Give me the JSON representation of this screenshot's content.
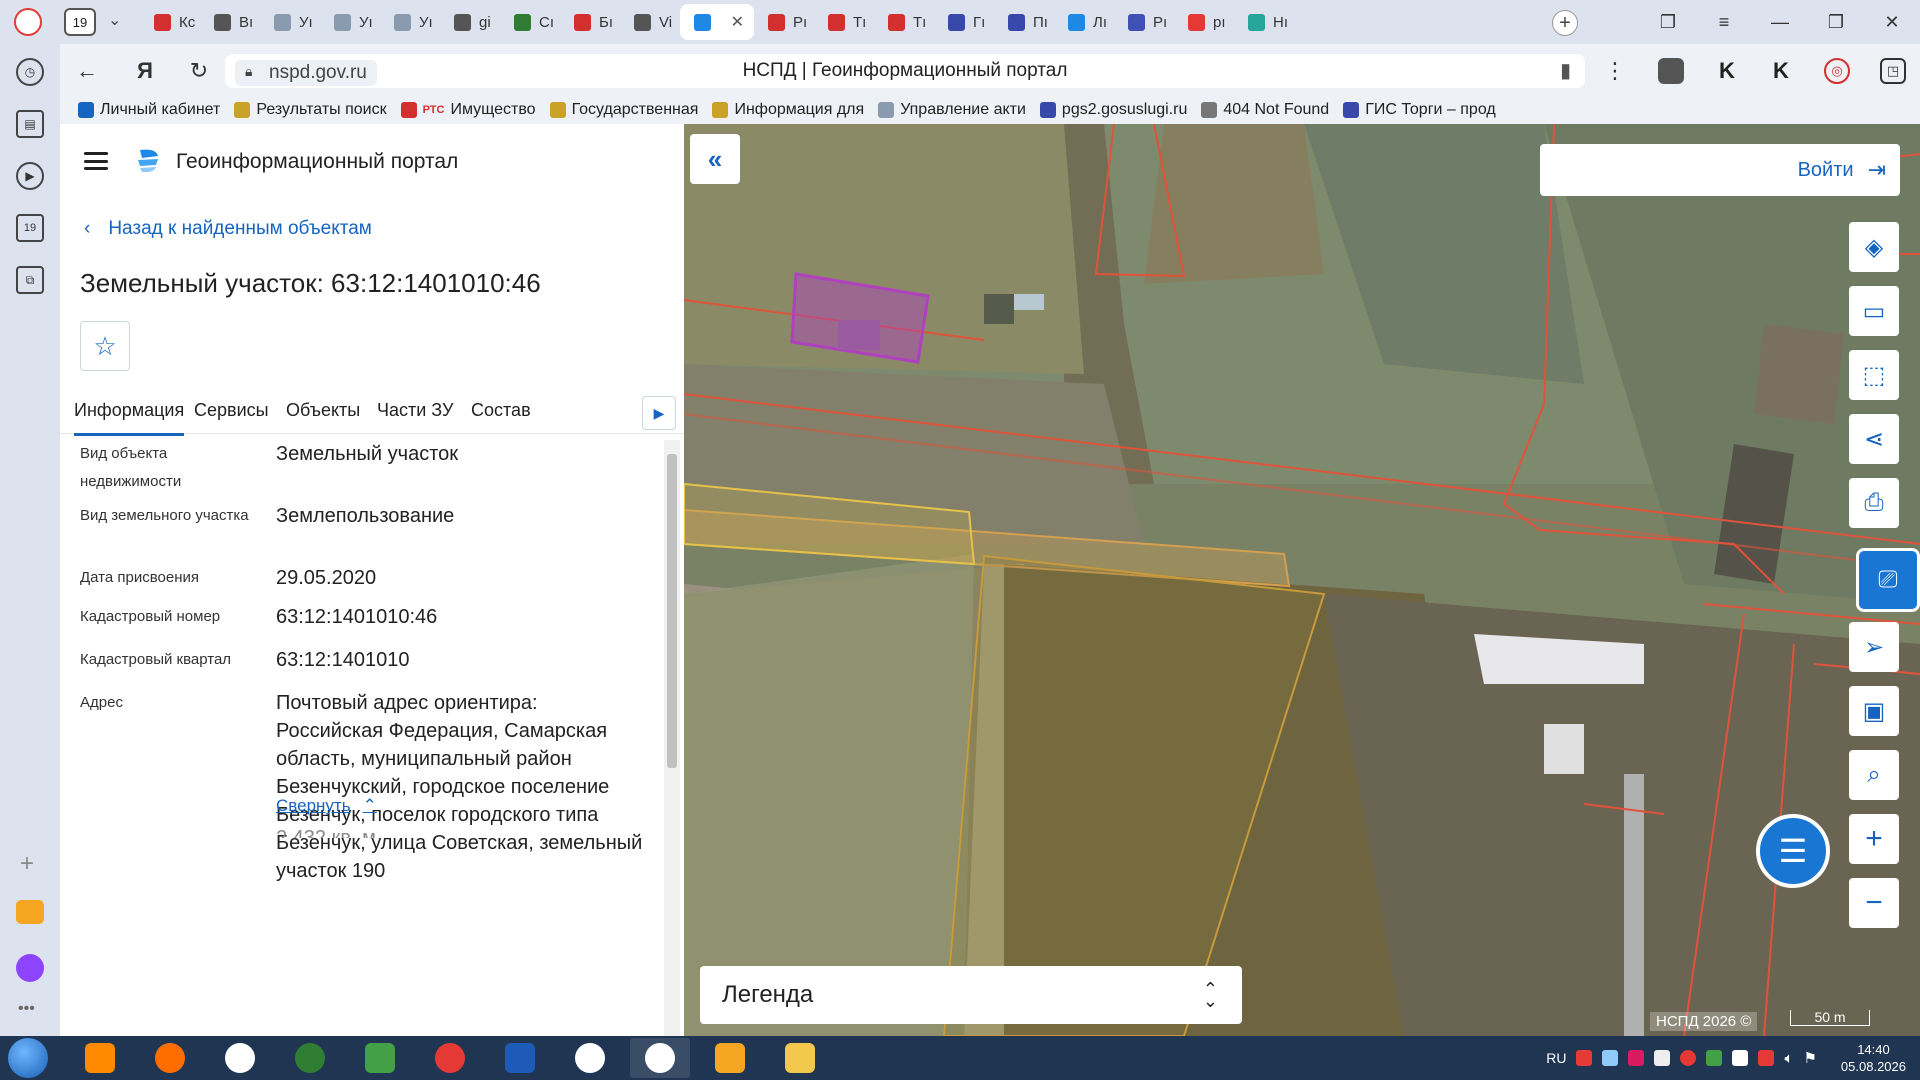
{
  "browser": {
    "tab_counter": "19",
    "tabs": [
      {
        "label": "Кc",
        "icon": "pdf-icon",
        "color": "#d32f2f"
      },
      {
        "label": "Вı",
        "icon": "document-icon",
        "color": "#555555"
      },
      {
        "label": "Уı",
        "icon": "emblem-icon",
        "color": "#8a9bb0"
      },
      {
        "label": "Уı",
        "icon": "emblem-icon",
        "color": "#8a9bb0"
      },
      {
        "label": "Уı",
        "icon": "emblem-icon",
        "color": "#8a9bb0"
      },
      {
        "label": "gi",
        "icon": "document-icon",
        "color": "#555555"
      },
      {
        "label": "Сı",
        "icon": "m-icon",
        "color": "#2e7d32"
      },
      {
        "label": "Бı",
        "icon": "pdf-icon",
        "color": "#d32f2f"
      },
      {
        "label": "Vi",
        "icon": "document-icon",
        "color": "#555555"
      },
      {
        "label": "",
        "icon": "nspd-icon",
        "color": "#1e88e5",
        "active": true
      },
      {
        "label": "Рı",
        "icon": "pdf-icon",
        "color": "#d32f2f"
      },
      {
        "label": "Тı",
        "icon": "pdf-icon",
        "color": "#d32f2f"
      },
      {
        "label": "Тı",
        "icon": "pdf-icon",
        "color": "#d32f2f"
      },
      {
        "label": "Гı",
        "icon": "eagle-icon",
        "color": "#3949ab"
      },
      {
        "label": "Пı",
        "icon": "eagle-icon",
        "color": "#3949ab"
      },
      {
        "label": "Лı",
        "icon": "shield-icon",
        "color": "#1e88e5"
      },
      {
        "label": "Рı",
        "icon": "people-icon",
        "color": "#3f51b5"
      },
      {
        "label": "рı",
        "icon": "yandex-icon",
        "color": "#e53935"
      },
      {
        "label": "Нı",
        "icon": "globe-icon",
        "color": "#26a69a"
      }
    ],
    "url_host": "nspd.gov.ru",
    "page_title": "НСПД | Геоинформационный портал",
    "download_badge": "3",
    "bookmarks": [
      {
        "label": "Личный кабинет",
        "color": "#1565c0"
      },
      {
        "label": "Результаты поиск",
        "color": "#c9a227"
      },
      {
        "label": "Имущество",
        "color": "#d32f2f",
        "prefix": "РТС"
      },
      {
        "label": "Государственная",
        "color": "#c9a227"
      },
      {
        "label": "Информация для",
        "color": "#c9a227"
      },
      {
        "label": "Управление акти",
        "color": "#8a9bb0"
      },
      {
        "label": "pgs2.gosuslugi.ru",
        "color": "#3949ab"
      },
      {
        "label": "404 Not Found",
        "color": "#777777"
      },
      {
        "label": "ГИС Торги – прод",
        "color": "#3949ab"
      }
    ]
  },
  "panel": {
    "portal_title": "Геоинформационный портал",
    "back_label": "Назад к найденным объектам",
    "object_title": "Земельный участок: 63:12:1401010:46",
    "tabs": [
      "Информация",
      "Сервисы",
      "Объекты",
      "Части ЗУ",
      "Состав"
    ],
    "fields": [
      {
        "label": "Вид объекта недвижимости",
        "value": "Земельный участок"
      },
      {
        "label": "Вид земельного участка",
        "value": "Землепользование"
      },
      {
        "label": "Дата присвоения",
        "value": "29.05.2020"
      },
      {
        "label": "Кадастровый номер",
        "value": "63:12:1401010:46"
      },
      {
        "label": "Кадастровый квартал",
        "value": "63:12:1401010"
      },
      {
        "label": "Адрес",
        "value": "Почтовый адрес ориентира: Российская Федерация, Самарская область, муниципальный район Безенчукский, городское поселение Безенчук, поселок городского типа Безенчук, улица Советская, земельный участок 190"
      }
    ],
    "collapse_label": "Свернуть",
    "next_value_partial": "2 432 кв. м"
  },
  "map": {
    "login_label": "Войти",
    "legend_label": "Легенда",
    "copyright": "НСПД 2026 ©",
    "scale_label": "50 m",
    "tools": [
      "layers-icon",
      "ruler-icon",
      "select-area-icon",
      "share-icon",
      "print-icon",
      "doc-scan-icon",
      "locate-icon",
      "minimap-icon",
      "search-location-icon",
      "zoom-in-icon",
      "zoom-out-icon"
    ],
    "parcel_color": "#b040c0",
    "boundary_color": "#e0533a"
  },
  "taskbar": {
    "lang": "RU",
    "time": "14:40",
    "date": "05.08.2026",
    "apps": [
      "media-player",
      "firefox",
      "yandex-browser",
      "chrome",
      "green-app",
      "red-app",
      "word",
      "c-app",
      "yandex-browser-2",
      "mail",
      "explorer"
    ]
  }
}
